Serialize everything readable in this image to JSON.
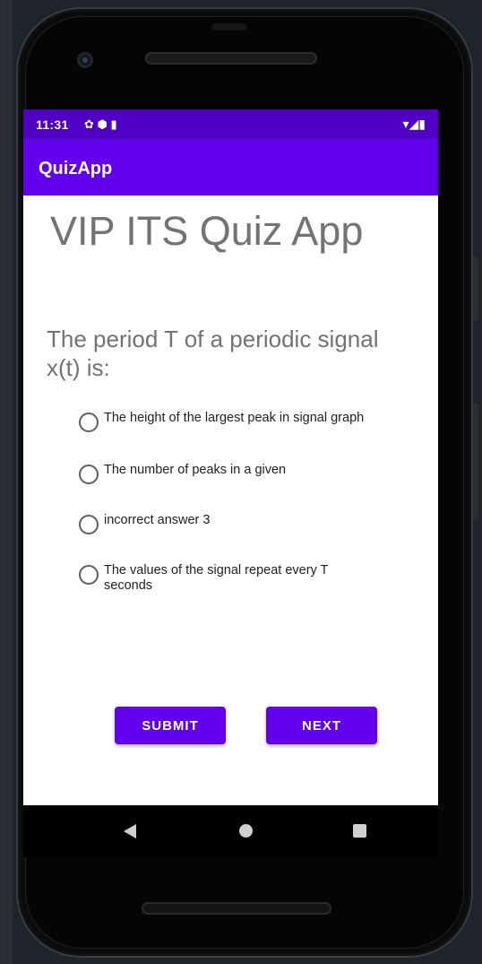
{
  "status_bar": {
    "time": "11:31",
    "left_icons": "✿ ⬢ ▮",
    "right_icons": "▾◢▮"
  },
  "app_bar": {
    "title": "QuizApp"
  },
  "main": {
    "title": "VIP ITS Quiz App",
    "question": "The period T of a periodic signal x(t) is:",
    "options": [
      {
        "label": "The height of the largest peak in signal graph",
        "selected": false
      },
      {
        "label": "The number of peaks in a given",
        "selected": false
      },
      {
        "label": "incorrect answer 3",
        "selected": false
      },
      {
        "label": "The values of the signal repeat every T seconds",
        "selected": false
      }
    ],
    "submit_label": "SUBMIT",
    "next_label": "NEXT"
  },
  "nav_bar": {
    "back": "back-icon",
    "home": "home-icon",
    "recents": "recents-icon"
  },
  "colors": {
    "primary": "#6200ee",
    "status_bar": "#4f00c4",
    "text_gray": "#737373"
  }
}
